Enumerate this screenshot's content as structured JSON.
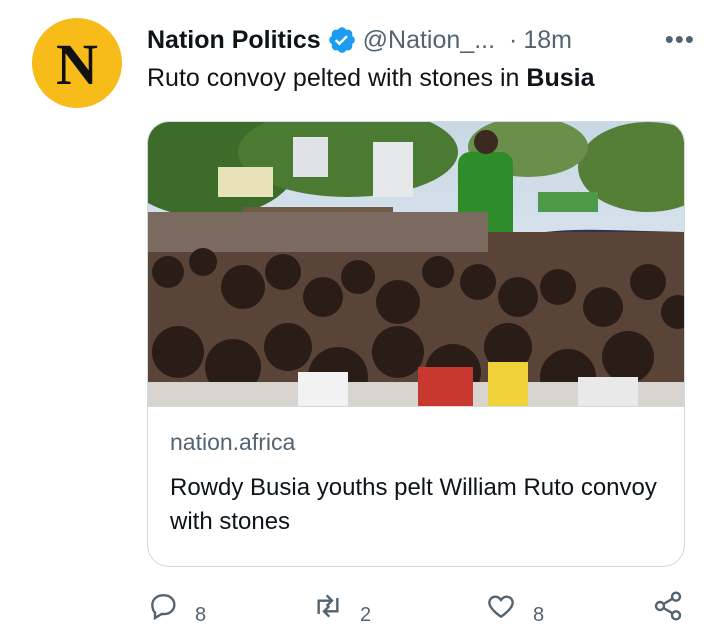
{
  "tweet": {
    "avatar_letter": "N",
    "display_name": "Nation Politics",
    "handle": "@Nation_...",
    "separator": "·",
    "time": "18m",
    "more": "•••",
    "text_prefix": "Ruto convoy pelted with stones in ",
    "text_bold": "Busia"
  },
  "card": {
    "domain": "nation.africa",
    "title": "Rowdy Busia youths pelt William Ruto convoy with stones"
  },
  "actions": {
    "reply_count": "8",
    "retweet_count": "2",
    "like_count": "8"
  },
  "icons": [
    "verified-badge-icon",
    "more-options-icon",
    "reply-icon",
    "retweet-icon",
    "like-icon",
    "share-icon"
  ],
  "colors": {
    "avatar_bg": "#f7bb1a",
    "verified": "#1d9bf0",
    "secondary_text": "#536471",
    "primary_text": "#0f1419",
    "border": "#cfd9de"
  }
}
